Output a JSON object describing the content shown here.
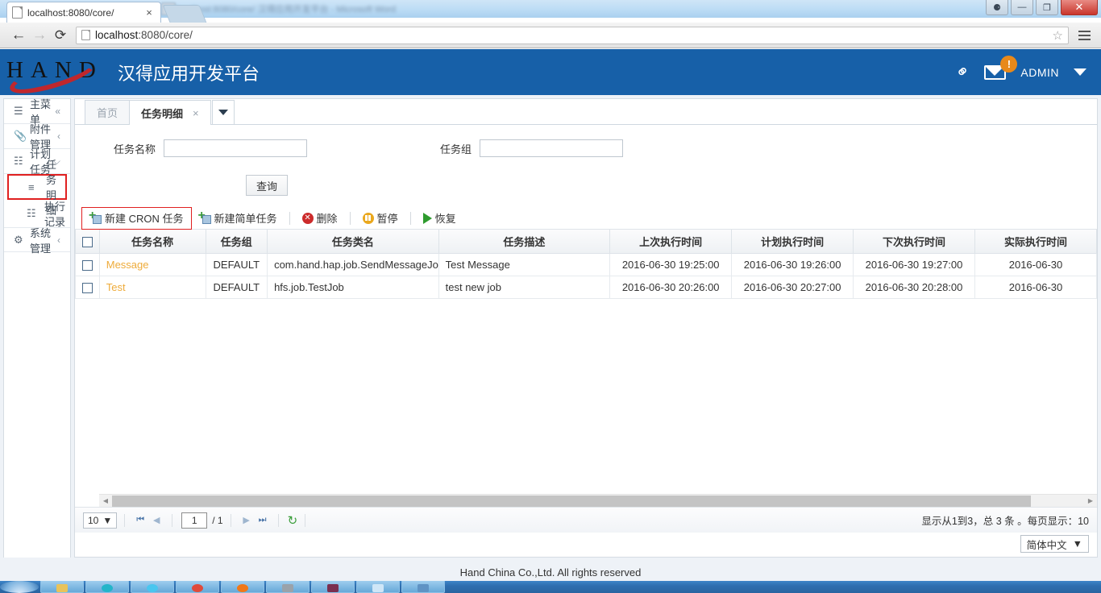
{
  "browser": {
    "tab_title": "localhost:8080/core/",
    "tab_close": "×",
    "url_host": "localhost",
    "url_rest": ":8080/core/",
    "back_icon": "←",
    "forward_icon": "→",
    "reload_icon": "⟳",
    "star_icon": "☆",
    "minimize_label": "—",
    "restore_label": "❐",
    "close_label": "✕",
    "user_label": "⚈",
    "bg_window_title": "localhost:8080/core/ 汉得应用开发平台 - Microsoft Word"
  },
  "app": {
    "logo_text": "HAND",
    "title": "汉得应用开发平台",
    "user": "ADMIN",
    "badge": "!",
    "icons": {
      "chain": "⚭",
      "envelope": "envelope-icon"
    }
  },
  "sidebar": {
    "items": [
      {
        "label": "主菜单",
        "icon": "☰",
        "chevron": "«"
      },
      {
        "label": "附件管理",
        "icon": "📎",
        "chevron": "‹"
      },
      {
        "label": "计划任务",
        "icon": "☷",
        "chevron": "⌵"
      }
    ],
    "sub_items": [
      {
        "label": "任务明细",
        "icon": "≡",
        "selected": true
      },
      {
        "label": "执行记录",
        "icon": "☷",
        "selected": false
      }
    ],
    "bottom_items": [
      {
        "label": "系统管理",
        "icon": "⚙",
        "chevron": "‹"
      }
    ]
  },
  "tabs": {
    "items": [
      {
        "label": "首页",
        "active": false,
        "closable": false
      },
      {
        "label": "任务明细",
        "active": true,
        "closable": true
      }
    ],
    "close_glyph": "×"
  },
  "search_form": {
    "fields": [
      {
        "label": "任务名称",
        "value": "",
        "placeholder": ""
      },
      {
        "label": "任务组",
        "value": "",
        "placeholder": ""
      }
    ],
    "query_button": "查询"
  },
  "toolbar": {
    "buttons": [
      {
        "label": "新建 CRON 任务",
        "icon": "new-job-icon",
        "highlighted": true
      },
      {
        "label": "新建简单任务",
        "icon": "new-job-icon",
        "highlighted": false
      },
      {
        "label": "删除",
        "icon": "delete-icon",
        "highlighted": false
      },
      {
        "label": "暂停",
        "icon": "pause-icon",
        "highlighted": false
      },
      {
        "label": "恢复",
        "icon": "play-icon",
        "highlighted": false
      }
    ]
  },
  "grid": {
    "columns": [
      "任务名称",
      "任务组",
      "任务类名",
      "任务描述",
      "上次执行时间",
      "计划执行时间",
      "下次执行时间",
      "实际执行时间"
    ],
    "rows": [
      {
        "name": "Message",
        "group": "DEFAULT",
        "class": "com.hand.hap.job.SendMessageJob",
        "desc": "Test Message",
        "last_time": "2016-06-30 19:25:00",
        "plan_time": "2016-06-30 19:26:00",
        "next_time": "2016-06-30 19:27:00",
        "actual_time": "2016-06-30"
      },
      {
        "name": "Test",
        "group": "DEFAULT",
        "class": "hfs.job.TestJob",
        "desc": "test new job",
        "last_time": "2016-06-30 20:26:00",
        "plan_time": "2016-06-30 20:27:00",
        "next_time": "2016-06-30 20:28:00",
        "actual_time": "2016-06-30"
      }
    ]
  },
  "pager": {
    "page_size": "10",
    "caret": "▼",
    "first_icon": "⏮",
    "prev_icon": "◀",
    "next_icon": "▶",
    "last_icon": "⏭",
    "refresh_icon": "↻",
    "current_page": "1",
    "total_pages": "/ 1",
    "status": "显示从1到3，总 3 条 。每页显示：10"
  },
  "language": {
    "selected": "简体中文",
    "caret": "▼"
  },
  "footer": {
    "copyright": "Hand China Co.,Ltd. All rights reserved"
  },
  "scrollbar": {
    "left_arrow": "◀",
    "right_arrow": "▶"
  }
}
